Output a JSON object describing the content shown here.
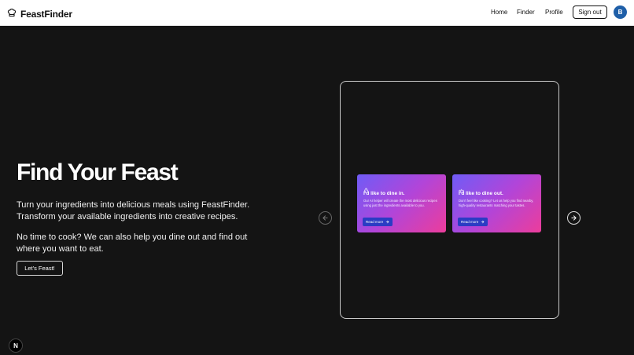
{
  "nav": {
    "brand": "FeastFinder",
    "brand_icon": "chef-hat-icon",
    "links": [
      "Home",
      "Finder",
      "Profile"
    ],
    "signout_label": "Sign out",
    "avatar_initial": "B",
    "avatar_color": "#1f5fa8"
  },
  "hero": {
    "title": "Find Your Feast",
    "paragraph1": "Turn your ingredients into delicious meals using FeastFinder. Transform your available ingredients into creative recipes.",
    "paragraph2": "No time to cook? We can also help you dine out and find out where you want to eat.",
    "cta_label": "Let's Feast!"
  },
  "carousel": {
    "prev_icon": "arrow-left-icon",
    "next_icon": "arrow-right-icon",
    "cards": [
      {
        "icon": "cooking-pot-icon",
        "title": "I'd like to dine in.",
        "text": "Our AI helper will create the most delicious recipes using just the ingredients available to you.",
        "button_label": "Read more"
      },
      {
        "icon": "dining-icon",
        "title": "I'd like to dine out.",
        "text": "Don't feel like cooking? Let us help you find nearby, high-quality restaurants matching your tastes.",
        "button_label": "Read more"
      }
    ],
    "gradient": [
      "#6f5cf6",
      "#b145d9",
      "#ec3d9b"
    ]
  },
  "badge": {
    "label": "N"
  }
}
